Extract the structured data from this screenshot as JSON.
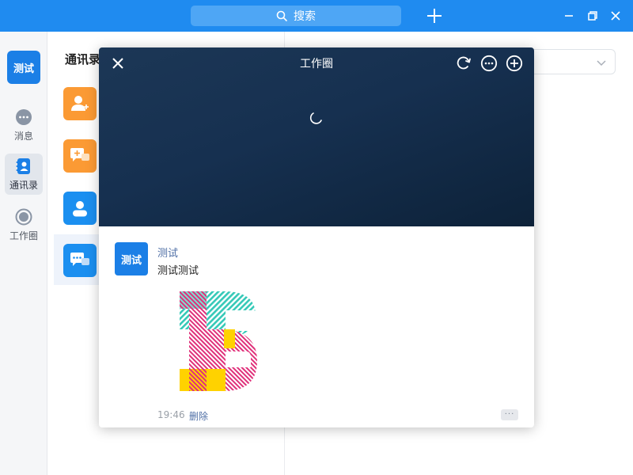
{
  "topbar": {
    "search_label": "搜索",
    "colors": {
      "background": "#1f8bf0",
      "search_bg": "#4ea6f5"
    }
  },
  "nav": {
    "avatar_text": "测试",
    "items": [
      {
        "label": "消息",
        "icon": "chat-bubble-icon"
      },
      {
        "label": "通讯录",
        "icon": "contacts-book-icon",
        "active": true
      },
      {
        "label": "工作圈",
        "icon": "work-circle-icon"
      }
    ]
  },
  "contacts": {
    "title": "通讯录",
    "rows": [
      {
        "icon": "add-friend-icon",
        "color": "#fb9a34"
      },
      {
        "icon": "group-chat-add-icon",
        "color": "#fb9a34"
      },
      {
        "icon": "user-icon",
        "color": "#1b8ff0"
      },
      {
        "icon": "group-chat-icon",
        "color": "#1b8ff0",
        "active": true
      }
    ]
  },
  "dialog": {
    "title": "工作圈",
    "post": {
      "avatar_text": "测试",
      "author": "测试",
      "content": "测试测试",
      "time": "19:46",
      "delete_label": "删除",
      "more_label": "···",
      "image_icon": "letter-b-image"
    }
  }
}
